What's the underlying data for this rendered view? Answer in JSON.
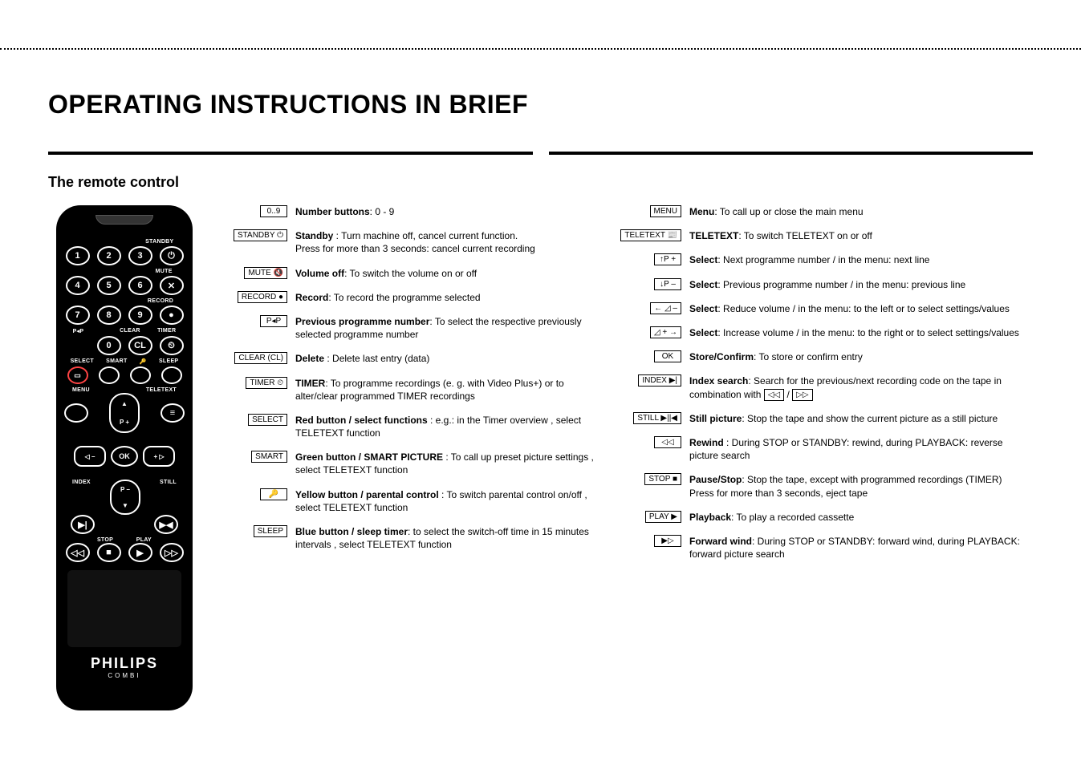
{
  "title": "OPERATING INSTRUCTIONS IN BRIEF",
  "section_title": "The remote control",
  "brand": "PHILIPS",
  "brand_sub": "COMBI",
  "remote_labels": {
    "standby": "STANDBY",
    "mute": "MUTE",
    "record": "RECORD",
    "pap": "P◂P",
    "clear": "CLEAR",
    "timer": "TIMER",
    "select": "SELECT",
    "smart": "SMART",
    "key_parental": "🔑",
    "sleep": "SLEEP",
    "menu": "MENU",
    "teletext": "TELETEXT",
    "index": "INDEX",
    "still": "STILL",
    "stop": "STOP",
    "play": "PLAY",
    "p_plus": "P +",
    "p_minus": "P –",
    "ok": "OK",
    "vol_minus": "◁ –",
    "vol_plus": "+ ▷",
    "cl": "CL"
  },
  "left": [
    {
      "key": "0..9",
      "title": "Number buttons",
      "text": ": 0 - 9"
    },
    {
      "key": "STANDBY ⏻",
      "title": "Standby",
      "text": " : Turn machine off, cancel current function.\nPress for more than 3 seconds: cancel current recording"
    },
    {
      "key": "MUTE 🔇",
      "title": "Volume off",
      "text": ": To switch the volume on or off"
    },
    {
      "key": "RECORD ●",
      "title": "Record",
      "text": ": To record the programme selected"
    },
    {
      "key": "P◂P",
      "title": "Previous programme number",
      "text": ": To select the respective previously selected programme number"
    },
    {
      "key": "CLEAR (CL)",
      "title": "Delete",
      "text": " : Delete last entry (data)"
    },
    {
      "key": "TIMER ⏲",
      "title": "TIMER",
      "text": ": To programme recordings (e. g. with Video Plus+) or to alter/clear programmed TIMER recordings"
    },
    {
      "key": "SELECT",
      "title": "Red button / select functions",
      "text": " : e.g.: in the Timer overview , select TELETEXT function"
    },
    {
      "key": "SMART",
      "title": "Green button / SMART PICTURE",
      "text": " : To call up preset picture settings , select TELETEXT function"
    },
    {
      "key": "🔑",
      "title": "Yellow button / parental control",
      "text": " : To switch parental control on/off , select TELETEXT function"
    },
    {
      "key": "SLEEP",
      "title": "Blue button / sleep timer",
      "text": ": to select the switch-off time in 15 minutes intervals , select TELETEXT function"
    }
  ],
  "right": [
    {
      "key": "MENU",
      "title": "Menu",
      "text": ": To call up or close the main menu"
    },
    {
      "key": "TELETEXT 📰",
      "title": "TELETEXT",
      "text": ": To switch TELETEXT on or off"
    },
    {
      "key": "↑P +",
      "title": "Select",
      "text": ": Next programme number / in the menu: next line"
    },
    {
      "key": "↓P –",
      "title": "Select",
      "text": ": Previous programme number / in the menu: previous line"
    },
    {
      "key": "← ◿ –",
      "title": "Select",
      "text": ": Reduce volume / in the menu: to the left or to select settings/values"
    },
    {
      "key": "◿ + →",
      "title": "Select",
      "text": ": Increase volume / in the menu: to the right or to select settings/values"
    },
    {
      "key": "OK",
      "title": "Store/Confirm",
      "text": ": To store or confirm entry"
    },
    {
      "key": "INDEX ▶|",
      "title": "Index search",
      "text": ": Search for the previous/next recording code on the tape in combination with ",
      "suffix_keys": [
        "◁◁",
        "▷▷"
      ]
    },
    {
      "key": "STILL ▶||◀",
      "title": "Still picture",
      "text": ": Stop the tape and show the current picture as a still picture"
    },
    {
      "key": "◁◁",
      "title": "Rewind",
      "text": " : During STOP or STANDBY: rewind, during PLAYBACK: reverse picture search"
    },
    {
      "key": "STOP ■",
      "title": "Pause/Stop",
      "text": ": Stop the tape, except with programmed recordings (TIMER)\nPress for more than 3 seconds, eject tape"
    },
    {
      "key": "PLAY ▶",
      "title": "Playback",
      "text": ": To play a recorded cassette"
    },
    {
      "key": "▶▷",
      "title": "Forward wind",
      "text": ": During STOP or STANDBY: forward wind, during PLAYBACK: forward picture search"
    }
  ]
}
